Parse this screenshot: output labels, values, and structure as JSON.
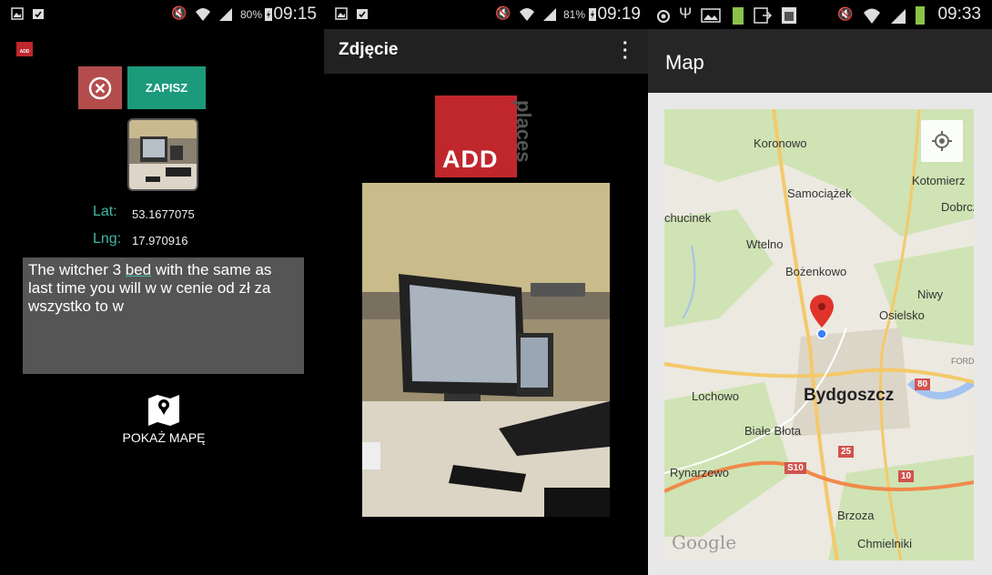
{
  "screen1": {
    "status": {
      "battery": "80%",
      "time": "09:15"
    },
    "app_icon_text": "ADD",
    "cancel_button": "⊗",
    "save_button": "ZAPISZ",
    "lat_label": "Lat:",
    "lat_value": "53.1677075",
    "lng_label": "Lng:",
    "lng_value": "17.970916",
    "note_text_before": "The witcher 3 ",
    "note_text_underlined": "bed",
    "note_text_after": " with the same as last time you will w w cenie od zł za wszystko to w",
    "show_map_label": "POKAŻ MAPĘ",
    "show_map_icon": "map-pin-icon"
  },
  "screen2": {
    "status": {
      "battery": "81%",
      "time": "09:19"
    },
    "title": "Zdjęcie",
    "logo": {
      "main": "ADD",
      "side": "places"
    }
  },
  "screen3": {
    "status": {
      "time": "09:33"
    },
    "title": "Map",
    "map_labels": [
      {
        "text": "Koronowo"
      },
      {
        "text": "Samociążek"
      },
      {
        "text": "Kotomierz"
      },
      {
        "text": "Dobrcz"
      },
      {
        "text": "chucinek"
      },
      {
        "text": "Wtelno"
      },
      {
        "text": "Bożenkowo"
      },
      {
        "text": "Niwy"
      },
      {
        "text": "Osielsko"
      },
      {
        "text": "FORD"
      },
      {
        "text": "Lochowo"
      },
      {
        "text": "Białe Błota"
      },
      {
        "text": "Rynarzewo"
      },
      {
        "text": "Brzoza"
      },
      {
        "text": "Chmielniki"
      }
    ],
    "city": "Bydgoszcz",
    "shields": [
      "80",
      "25",
      "S10",
      "10"
    ],
    "attribution": "Google"
  },
  "colors": {
    "accent": "#1b9b7c",
    "cancel": "#b44c4c",
    "brand_red": "#c0272d",
    "label_teal": "#3fb9a4"
  }
}
